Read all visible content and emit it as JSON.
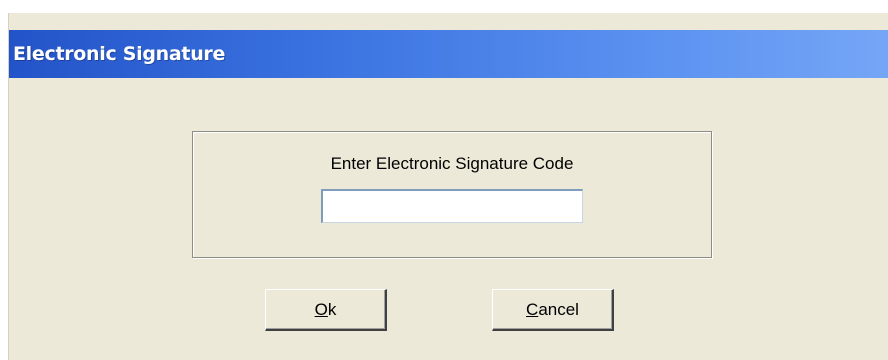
{
  "dialog": {
    "title": "Electronic Signature"
  },
  "form": {
    "prompt": "Enter Electronic Signature Code",
    "code_value": ""
  },
  "buttons": {
    "ok": {
      "mnemonic": "O",
      "rest": "k"
    },
    "cancel": {
      "mnemonic": "C",
      "rest": "ancel"
    }
  },
  "colors": {
    "dialog_background": "#ece9d8",
    "titlebar_start": "#2353c8",
    "titlebar_end": "#75a6f6",
    "title_text": "#ffffff"
  }
}
